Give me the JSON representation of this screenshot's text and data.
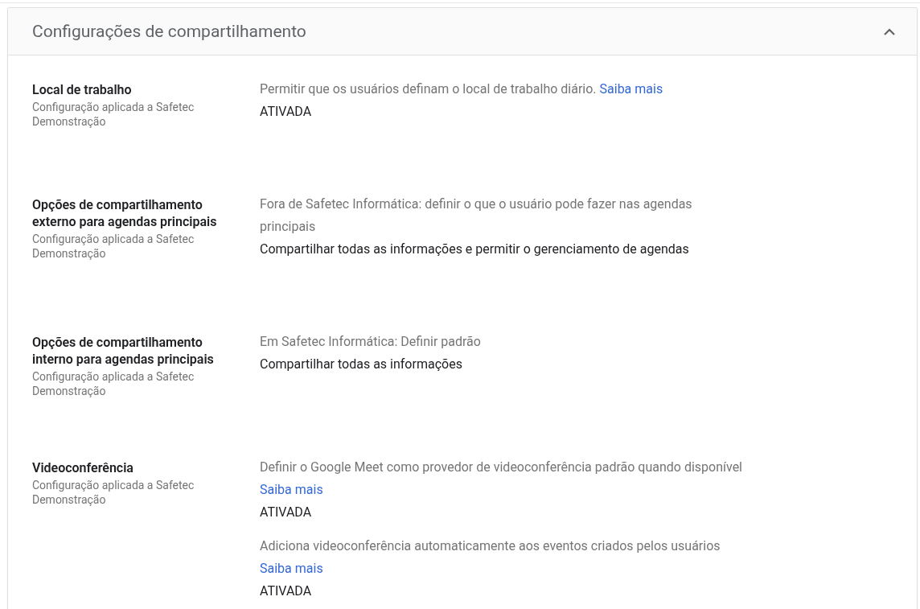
{
  "panel": {
    "title": "Configurações de compartilhamento",
    "expanded": true
  },
  "settings": [
    {
      "name": "Local de trabalho",
      "scope": "Configuração aplicada a Safetec Demonstração",
      "options": [
        {
          "description": "Permitir que os usuários definam o local de trabalho diário.",
          "link": "Saiba mais",
          "value": "ATIVADA"
        }
      ]
    },
    {
      "name": "Opções de compartilhamento externo para agendas principais",
      "scope": "Configuração aplicada a Safetec Demonstração",
      "options": [
        {
          "description": "Fora de Safetec Informática: definir o que o usuário pode fazer nas agendas principais",
          "value": "Compartilhar todas as informações e permitir o gerenciamento de agendas"
        }
      ]
    },
    {
      "name": "Opções de compartilhamento interno para agendas principais",
      "scope": "Configuração aplicada a Safetec Demonstração",
      "options": [
        {
          "description": "Em Safetec Informática: Definir padrão",
          "value": "Compartilhar todas as informações"
        }
      ]
    },
    {
      "name": "Videoconferência",
      "scope": "Configuração aplicada a Safetec Demonstração",
      "options": [
        {
          "description": "Definir o Google Meet como provedor de videoconferência padrão quando disponível",
          "link": "Saiba mais",
          "value": "ATIVADA"
        },
        {
          "description": "Adiciona videoconferência automaticamente aos eventos criados pelos usuários",
          "link": "Saiba mais",
          "value": "ATIVADA"
        }
      ]
    }
  ]
}
